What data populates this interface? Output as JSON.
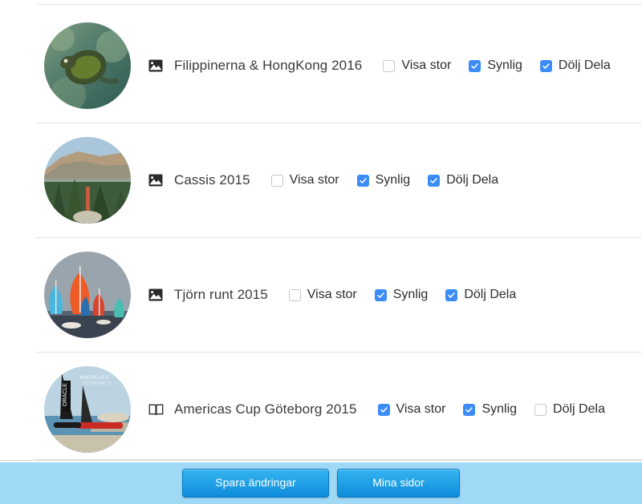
{
  "albums": [
    {
      "title": "Filippinerna & HongKong 2016",
      "icon": "image-icon",
      "thumb": "underwater-turtle-photo",
      "options": [
        {
          "label": "Visa stor",
          "checked": false
        },
        {
          "label": "Synlig",
          "checked": true
        },
        {
          "label": "Dölj Dela",
          "checked": true
        }
      ]
    },
    {
      "title": "Cassis 2015",
      "icon": "image-icon",
      "thumb": "coastal-pine-cliff-photo",
      "options": [
        {
          "label": "Visa stor",
          "checked": false
        },
        {
          "label": "Synlig",
          "checked": true
        },
        {
          "label": "Dölj Dela",
          "checked": true
        }
      ]
    },
    {
      "title": "Tjörn runt 2015",
      "icon": "image-icon",
      "thumb": "sailboats-spinnakers-photo",
      "options": [
        {
          "label": "Visa stor",
          "checked": false
        },
        {
          "label": "Synlig",
          "checked": true
        },
        {
          "label": "Dölj Dela",
          "checked": true
        }
      ]
    },
    {
      "title": "Americas Cup Göteborg 2015",
      "icon": "book-icon",
      "thumb": "oracle-catamaran-photo",
      "options": [
        {
          "label": "Visa stor",
          "checked": true
        },
        {
          "label": "Synlig",
          "checked": true
        },
        {
          "label": "Dölj Dela",
          "checked": false
        }
      ]
    }
  ],
  "footer": {
    "save_label": "Spara ändringar",
    "mypages_label": "Mina sidor"
  },
  "colors": {
    "accent_blue": "#3b8cf5",
    "footer_bar": "#9fd9f6",
    "button_blue": "#23a3e8",
    "divider": "#e6e6e6",
    "text": "#3a3a3a"
  }
}
